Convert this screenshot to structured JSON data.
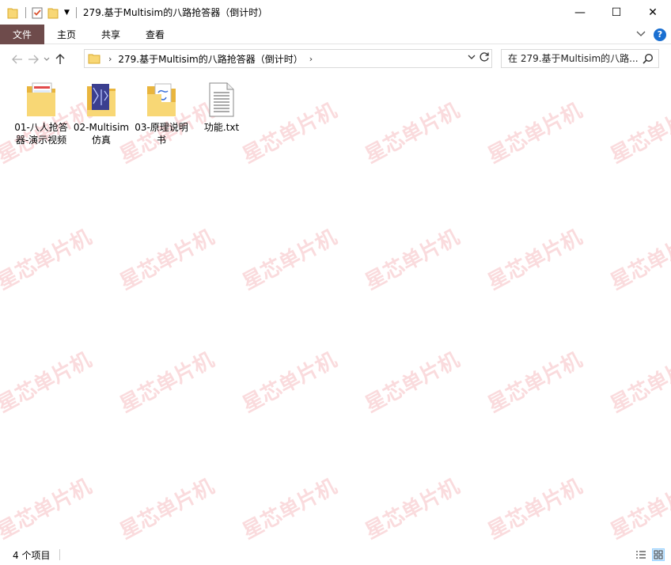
{
  "window": {
    "title": "279.基于Multisim的八路抢答器（倒计时）",
    "controls": {
      "minimize": "—",
      "maximize": "☐",
      "close": "✕"
    }
  },
  "ribbon": {
    "tabs": [
      {
        "label": "文件"
      },
      {
        "label": "主页"
      },
      {
        "label": "共享"
      },
      {
        "label": "查看"
      }
    ],
    "help": "?"
  },
  "address": {
    "crumb": "279.基于Multisim的八路抢答器（倒计时）"
  },
  "search": {
    "placeholder": "在 279.基于Multisim的八路..."
  },
  "files": [
    {
      "label": "01-八人抢答器-演示视频",
      "icon": "video-folder-icon"
    },
    {
      "label": "02-Multisim仿真",
      "icon": "document-folder-icon"
    },
    {
      "label": "03-原理说明书",
      "icon": "pdf-folder-icon"
    },
    {
      "label": "功能.txt",
      "icon": "text-file-icon"
    }
  ],
  "watermark": "星芯单片机",
  "status": {
    "item_count": "4 个项目"
  },
  "colors": {
    "file_tab": "#6e4b4b",
    "folder": "#f4c542",
    "watermark": "#e65a64"
  }
}
